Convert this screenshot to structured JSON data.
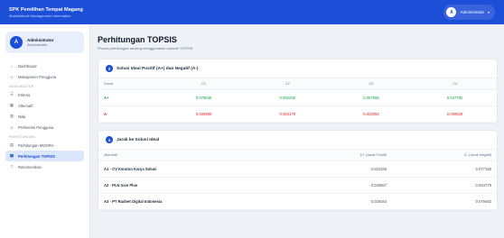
{
  "topbar": {
    "title": "SPK Pemilihan Tempat Magang",
    "subtitle": "Multiattribute Management Information",
    "user_initial": "A",
    "user_name": "Administrator"
  },
  "sidebar": {
    "profile_initial": "A",
    "profile_name": "Administrator",
    "profile_role": "Administrator",
    "items": [
      {
        "label": "Dashboard",
        "icon": "home-icon"
      },
      {
        "label": "Manajemen Pengguna",
        "icon": "users-icon"
      },
      {
        "section": "DATA MASTER"
      },
      {
        "label": "Kriteria",
        "icon": "list-icon"
      },
      {
        "label": "Alternatif",
        "icon": "building-icon"
      },
      {
        "label": "Nilai",
        "icon": "chart-icon"
      },
      {
        "label": "Preferensi Pengguna",
        "icon": "sliders-icon"
      },
      {
        "section": "PERHITUNGAN"
      },
      {
        "label": "Perhitungan MOORA",
        "icon": "calculator-icon"
      },
      {
        "label": "Perhitungan TOPSIS",
        "icon": "calculator-icon",
        "active": true
      },
      {
        "label": "Rekomendasi",
        "icon": "star-icon"
      }
    ]
  },
  "main": {
    "title": "Perhitungan TOPSIS",
    "subtitle": "Proses perhitungan ranking menggunakan metode TOPSIS",
    "ideal_card": {
      "number": "3",
      "title": "Solusi Ideal Positif (A+) dan Negatif (A-)",
      "headers": [
        "Solusi",
        "C1",
        "C2",
        "C3",
        "C4"
      ],
      "rows": [
        {
          "label": "A+",
          "values": [
            "0.078645",
            "0.052426",
            "0.057658",
            "0.047782"
          ]
        },
        {
          "label": "A-",
          "values": [
            "0.035989",
            "0.063179",
            "0.023083",
            "0.009526"
          ]
        }
      ]
    },
    "distance_card": {
      "number": "4",
      "title": "Jarak ke Solusi Ideal",
      "headers": [
        "Alternatif",
        "D+ (Jarak Positif)",
        "D- (Jarak Negatif)"
      ],
      "rows": [
        {
          "alt": "A1 - CV Keraton Karya Solusi",
          "dplus": "0.032335",
          "dminus": "0.077166"
        },
        {
          "alt": "A2 - PLN Icon Plus",
          "dplus": "0.035867",
          "dminus": "0.064778"
        },
        {
          "alt": "A3 - PT Radnet Digital Indonesia",
          "dplus": "0.025044",
          "dminus": "0.079482"
        }
      ]
    }
  },
  "colors": {
    "primary": "#1d4ed8",
    "positive": "#16a34a",
    "negative": "#dc2626"
  }
}
